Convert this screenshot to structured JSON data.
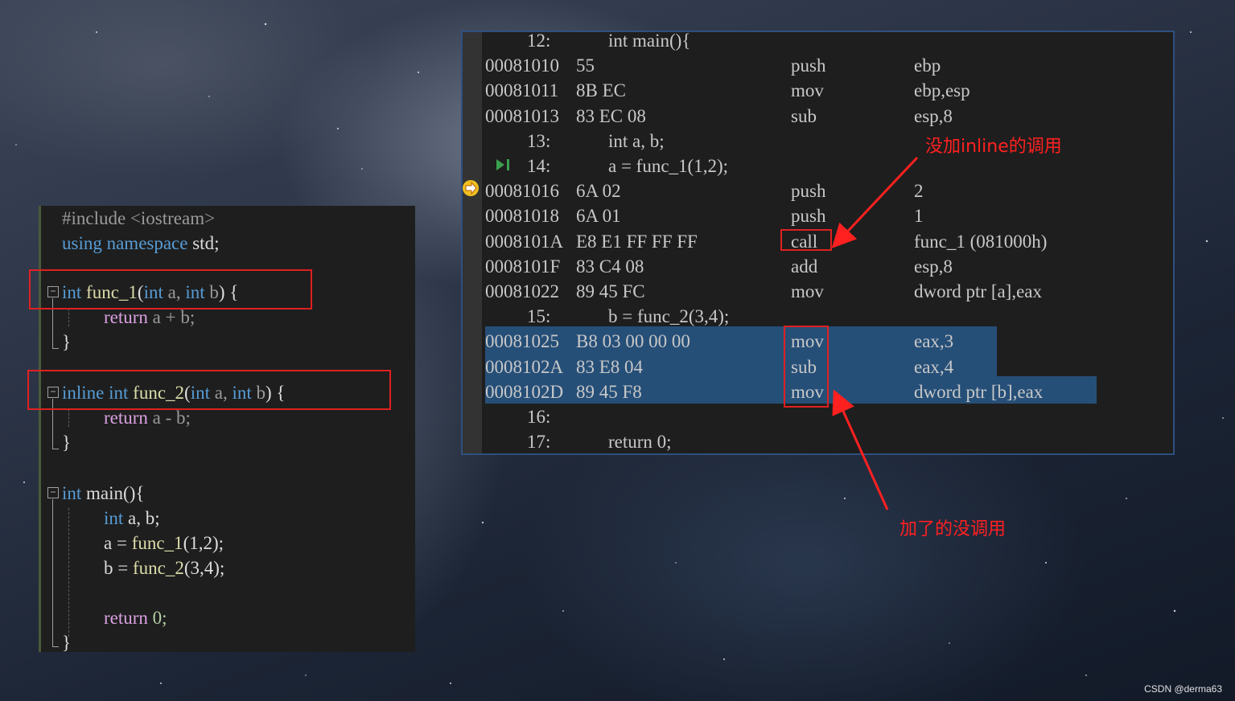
{
  "code": {
    "include": "#include <iostream>",
    "using_kw1": "using",
    "using_kw2": "namespace",
    "using_rest": " std;",
    "func1": {
      "kw": "int",
      "name": "func_1",
      "p1kw": "int",
      "p1": "a,",
      "p2kw": "int",
      "p2": "b",
      "brace": "{"
    },
    "func1_body": {
      "ret": "return",
      "expr": "a + b;"
    },
    "func2": {
      "inline": "inline",
      "kw": "int",
      "name": "func_2",
      "p1kw": "int",
      "p1": "a,",
      "p2kw": "int",
      "p2": "b",
      "brace": "{"
    },
    "func2_body": {
      "ret": "return",
      "expr": "a - b;"
    },
    "main": {
      "kw": "int",
      "name": "main",
      "sig": "(){"
    },
    "main_decl": {
      "kw": "int",
      "rest": "a, b;"
    },
    "main_a": {
      "lhs": "a =",
      "fn": "func_1",
      "args": "(1,2);"
    },
    "main_b": {
      "lhs": "b =",
      "fn": "func_2",
      "args": "(3,4);"
    },
    "main_ret": {
      "kw": "return",
      "val": "0;"
    },
    "close_brace": "}"
  },
  "disasm": {
    "lines": [
      {
        "kind": "src",
        "num": "12:",
        "text": "int main(){"
      },
      {
        "kind": "asm",
        "addr": "00081010",
        "bytes": "55",
        "op": "push",
        "args": "ebp"
      },
      {
        "kind": "asm",
        "addr": "00081011",
        "bytes": "8B EC",
        "op": "mov",
        "args": "ebp,esp"
      },
      {
        "kind": "asm",
        "addr": "00081013",
        "bytes": "83 EC 08",
        "op": "sub",
        "args": "esp,8"
      },
      {
        "kind": "src",
        "num": "13:",
        "text": "int a, b;"
      },
      {
        "kind": "src",
        "num": "14:",
        "text": "a = func_1(1,2);"
      },
      {
        "kind": "asm",
        "addr": "00081016",
        "bytes": "6A 02",
        "op": "push",
        "args": "2"
      },
      {
        "kind": "asm",
        "addr": "00081018",
        "bytes": "6A 01",
        "op": "push",
        "args": "1"
      },
      {
        "kind": "asm",
        "addr": "0008101A",
        "bytes": "E8 E1 FF FF FF",
        "op": "call",
        "args": "func_1 (081000h)"
      },
      {
        "kind": "asm",
        "addr": "0008101F",
        "bytes": "83 C4 08",
        "op": "add",
        "args": "esp,8"
      },
      {
        "kind": "asm",
        "addr": "00081022",
        "bytes": "89 45 FC",
        "op": "mov",
        "args": "dword ptr [a],eax"
      },
      {
        "kind": "src",
        "num": "15:",
        "text": "b = func_2(3,4);"
      },
      {
        "kind": "asm",
        "addr": "00081025",
        "bytes": "B8 03 00 00 00",
        "op": "mov",
        "args": "eax,3"
      },
      {
        "kind": "asm",
        "addr": "0008102A",
        "bytes": "83 E8 04",
        "op": "sub",
        "args": "eax,4"
      },
      {
        "kind": "asm",
        "addr": "0008102D",
        "bytes": "89 45 F8",
        "op": "mov",
        "args": "dword ptr [b],eax"
      },
      {
        "kind": "src",
        "num": "16:",
        "text": ""
      },
      {
        "kind": "src",
        "num": "17:",
        "text": "return 0;"
      }
    ]
  },
  "annotations": {
    "no_inline": "没加inline的调用",
    "inline": "加了的没调用"
  },
  "watermark": "CSDN @derma63",
  "colors": {
    "highlight": "#264f78",
    "annotation_red": "#ff2020"
  }
}
